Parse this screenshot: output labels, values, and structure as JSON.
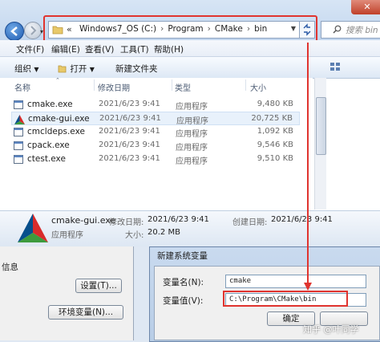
{
  "address": {
    "overflow": "«",
    "segments": [
      "Windows7_OS (C:)",
      "Program",
      "CMake",
      "bin"
    ],
    "search_placeholder": "搜索 bin"
  },
  "window_close": "✕",
  "menu": [
    "文件(F)",
    "编辑(E)",
    "查看(V)",
    "工具(T)",
    "帮助(H)"
  ],
  "toolbar": {
    "organize": "组织",
    "open": "打开",
    "new_folder": "新建文件夹"
  },
  "columns": {
    "name": "名称",
    "date": "修改日期",
    "type": "类型",
    "size": "大小"
  },
  "files": [
    {
      "name": "cmake.exe",
      "date": "2021/6/23 9:41",
      "type": "应用程序",
      "size": "9,480 KB",
      "icon": "exe-icon"
    },
    {
      "name": "cmake-gui.exe",
      "date": "2021/6/23 9:41",
      "type": "应用程序",
      "size": "20,725 KB",
      "icon": "cmake-logo-icon"
    },
    {
      "name": "cmcldeps.exe",
      "date": "2021/6/23 9:41",
      "type": "应用程序",
      "size": "1,092 KB",
      "icon": "exe-icon"
    },
    {
      "name": "cpack.exe",
      "date": "2021/6/23 9:41",
      "type": "应用程序",
      "size": "9,546 KB",
      "icon": "exe-icon"
    },
    {
      "name": "ctest.exe",
      "date": "2021/6/23 9:41",
      "type": "应用程序",
      "size": "9,510 KB",
      "icon": "exe-icon"
    }
  ],
  "details": {
    "name": "cmake-gui.exe",
    "modified_label": "修改日期:",
    "modified_value": "2021/6/23 9:41",
    "created_label": "创建日期:",
    "created_value": "2021/6/23 9:41",
    "type": "应用程序",
    "size_label": "大小:",
    "size_value": "20.2 MB"
  },
  "sysprops": {
    "partial_label": "信息",
    "settings_button": "设置(T)...",
    "env_button": "环境变量(N)..."
  },
  "dialog": {
    "title": "新建系统变量",
    "name_label": "变量名(N):",
    "name_value": "cmake",
    "value_label": "变量值(V):",
    "value_value": "C:\\Program\\CMake\\bin",
    "ok_button": "确定"
  },
  "watermark": "知乎 @叶同学"
}
